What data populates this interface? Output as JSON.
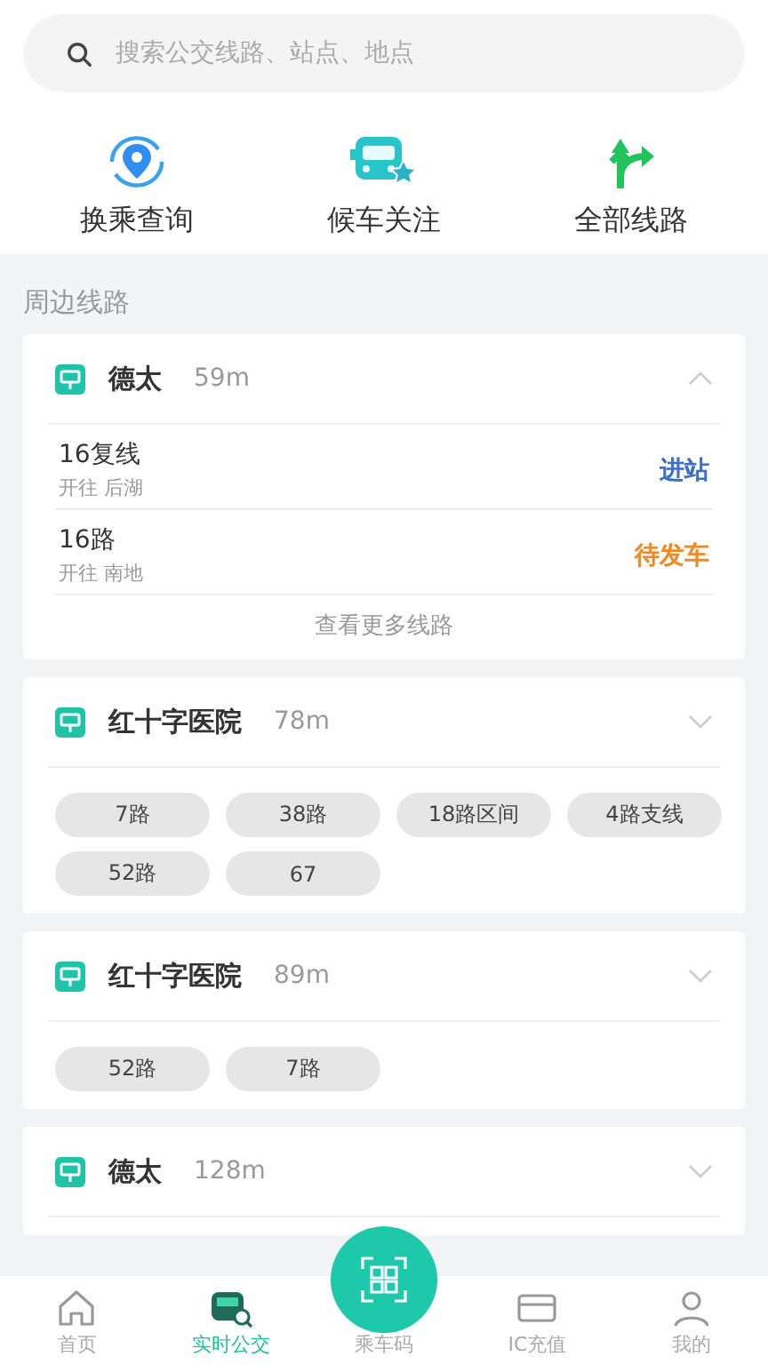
{
  "search": {
    "placeholder": "搜索公交线路、站点、地点"
  },
  "actions": [
    {
      "label": "换乘查询"
    },
    {
      "label": "候车关注"
    },
    {
      "label": "全部线路"
    }
  ],
  "section_title": "周边线路",
  "stations": [
    {
      "name": "德太",
      "distance": "59m",
      "expanded": true,
      "kind": "arrivals",
      "routes": [
        {
          "name": "16复线",
          "direction": "开往 后湖",
          "status": "进站",
          "color": "#3b6fc9"
        },
        {
          "name": "16路",
          "direction": "开往 南地",
          "status": "待发车",
          "color": "#f08a24"
        }
      ],
      "more": "查看更多线路"
    },
    {
      "name": "红十字医院",
      "distance": "78m",
      "expanded": false,
      "kind": "chips",
      "chips": [
        "7路",
        "38路",
        "18路区间",
        "4路支线",
        "52路",
        "67"
      ]
    },
    {
      "name": "红十字医院",
      "distance": "89m",
      "expanded": false,
      "kind": "chips",
      "chips": [
        "52路",
        "7路"
      ]
    },
    {
      "name": "德太",
      "distance": "128m",
      "expanded": false,
      "kind": "header"
    }
  ],
  "nav": [
    {
      "label": "首页",
      "selected": false
    },
    {
      "label": "实时公交",
      "selected": true
    },
    {
      "label": "乘车码",
      "selected": false
    },
    {
      "label": "IC充值",
      "selected": false
    },
    {
      "label": "我的",
      "selected": false
    }
  ]
}
